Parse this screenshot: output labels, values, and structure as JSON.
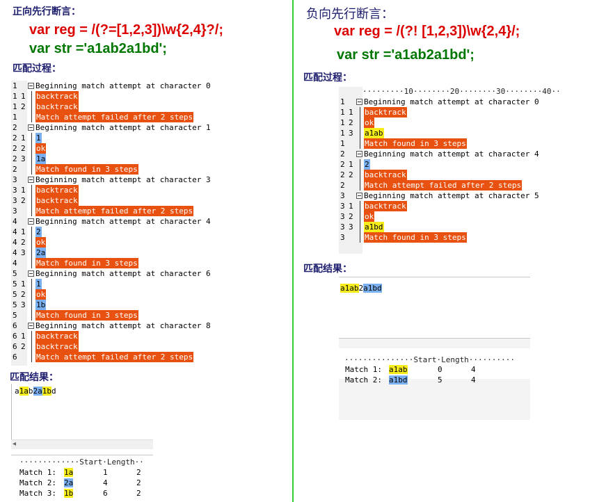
{
  "left": {
    "title": "正向先行断言：",
    "regex": "var reg = /(?=[1,2,3])\\w{2,4}?/;",
    "str": "var str ='a1ab2a1bd';",
    "process_label": "匹配过程：",
    "trace": [
      {
        "ln": "1",
        "step": "",
        "box": true,
        "text": "Beginning match attempt at character 0",
        "style": "plain"
      },
      {
        "ln": "1",
        "step": "1",
        "box": false,
        "text": "backtrack",
        "style": "orange"
      },
      {
        "ln": "1",
        "step": "2",
        "box": false,
        "text": "backtrack",
        "style": "orange"
      },
      {
        "ln": "1",
        "step": "",
        "box": false,
        "text": "Match attempt failed after 2 steps",
        "style": "orange"
      },
      {
        "ln": "2",
        "step": "",
        "box": true,
        "text": "Beginning match attempt at character 1",
        "style": "plain"
      },
      {
        "ln": "2",
        "step": "1",
        "box": false,
        "text": "1",
        "style": "blue"
      },
      {
        "ln": "2",
        "step": "2",
        "box": false,
        "text": "ok",
        "style": "orange"
      },
      {
        "ln": "2",
        "step": "3",
        "box": false,
        "text": "1a",
        "style": "blue"
      },
      {
        "ln": "2",
        "step": "",
        "box": false,
        "text": "Match found in 3 steps",
        "style": "orange"
      },
      {
        "ln": "3",
        "step": "",
        "box": true,
        "text": "Beginning match attempt at character 3",
        "style": "plain"
      },
      {
        "ln": "3",
        "step": "1",
        "box": false,
        "text": "backtrack",
        "style": "orange"
      },
      {
        "ln": "3",
        "step": "2",
        "box": false,
        "text": "backtrack",
        "style": "orange"
      },
      {
        "ln": "3",
        "step": "",
        "box": false,
        "text": "Match attempt failed after 2 steps",
        "style": "orange"
      },
      {
        "ln": "4",
        "step": "",
        "box": true,
        "text": "Beginning match attempt at character 4",
        "style": "plain"
      },
      {
        "ln": "4",
        "step": "1",
        "box": false,
        "text": "2",
        "style": "blue"
      },
      {
        "ln": "4",
        "step": "2",
        "box": false,
        "text": "ok",
        "style": "orange"
      },
      {
        "ln": "4",
        "step": "3",
        "box": false,
        "text": "2a",
        "style": "blue"
      },
      {
        "ln": "4",
        "step": "",
        "box": false,
        "text": "Match found in 3 steps",
        "style": "orange"
      },
      {
        "ln": "5",
        "step": "",
        "box": true,
        "text": "Beginning match attempt at character 6",
        "style": "plain"
      },
      {
        "ln": "5",
        "step": "1",
        "box": false,
        "text": "1",
        "style": "blue"
      },
      {
        "ln": "5",
        "step": "2",
        "box": false,
        "text": "ok",
        "style": "orange"
      },
      {
        "ln": "5",
        "step": "3",
        "box": false,
        "text": "1b",
        "style": "blue"
      },
      {
        "ln": "5",
        "step": "",
        "box": false,
        "text": "Match found in 3 steps",
        "style": "orange"
      },
      {
        "ln": "6",
        "step": "",
        "box": true,
        "text": "Beginning match attempt at character 8",
        "style": "plain"
      },
      {
        "ln": "6",
        "step": "1",
        "box": false,
        "text": "backtrack",
        "style": "orange"
      },
      {
        "ln": "6",
        "step": "2",
        "box": false,
        "text": "backtrack",
        "style": "orange"
      },
      {
        "ln": "6",
        "step": "",
        "box": false,
        "text": "Match attempt failed after 2 steps",
        "style": "orange"
      }
    ],
    "result_label": "匹配结果：",
    "result_segments": [
      {
        "t": "a",
        "c": ""
      },
      {
        "t": "1a",
        "c": "yellow"
      },
      {
        "t": "b",
        "c": ""
      },
      {
        "t": "2a",
        "c": "blue"
      },
      {
        "t": "1b",
        "c": "yellow"
      },
      {
        "t": "d",
        "c": ""
      }
    ],
    "table_header": "·············Start·Length··",
    "matches": [
      {
        "label": "Match 1:",
        "value": "1a",
        "color": "yellow",
        "start": "1",
        "length": "2"
      },
      {
        "label": "Match 2:",
        "value": "2a",
        "color": "blue",
        "start": "4",
        "length": "2"
      },
      {
        "label": "Match 3:",
        "value": "1b",
        "color": "yellow",
        "start": "6",
        "length": "2"
      }
    ]
  },
  "right": {
    "title": "负向先行断言：",
    "regex": "var reg = /(?! [1,2,3])\\w{2,4}/;",
    "str": "var str ='a1ab2a1bd';",
    "process_label": "匹配过程：",
    "ruler": "·········10········20········30········40··",
    "trace": [
      {
        "ln": "1",
        "step": "",
        "box": true,
        "text": "Beginning match attempt at character 0",
        "style": "plain"
      },
      {
        "ln": "1",
        "step": "1",
        "box": false,
        "text": "backtrack",
        "style": "orange"
      },
      {
        "ln": "1",
        "step": "2",
        "box": false,
        "text": "ok",
        "style": "orange"
      },
      {
        "ln": "1",
        "step": "3",
        "box": false,
        "text": "a1ab",
        "style": "yellow"
      },
      {
        "ln": "1",
        "step": "",
        "box": false,
        "text": "Match found in 3 steps",
        "style": "orange"
      },
      {
        "ln": "2",
        "step": "",
        "box": true,
        "text": "Beginning match attempt at character 4",
        "style": "plain"
      },
      {
        "ln": "2",
        "step": "1",
        "box": false,
        "text": "2",
        "style": "blue"
      },
      {
        "ln": "2",
        "step": "2",
        "box": false,
        "text": "backtrack",
        "style": "orange"
      },
      {
        "ln": "2",
        "step": "",
        "box": false,
        "text": "Match attempt failed after 2 steps",
        "style": "orange"
      },
      {
        "ln": "3",
        "step": "",
        "box": true,
        "text": "Beginning match attempt at character 5",
        "style": "plain"
      },
      {
        "ln": "3",
        "step": "1",
        "box": false,
        "text": "backtrack",
        "style": "orange"
      },
      {
        "ln": "3",
        "step": "2",
        "box": false,
        "text": "ok",
        "style": "orange"
      },
      {
        "ln": "3",
        "step": "3",
        "box": false,
        "text": "a1bd",
        "style": "yellow"
      },
      {
        "ln": "3",
        "step": "",
        "box": false,
        "text": "Match found in 3 steps",
        "style": "orange"
      }
    ],
    "result_label": "匹配结果：",
    "result_segments": [
      {
        "t": "a1ab",
        "c": "yellow"
      },
      {
        "t": "2",
        "c": ""
      },
      {
        "t": "a1bd",
        "c": "blue"
      }
    ],
    "table_header": "···············Start·Length··········",
    "matches": [
      {
        "label": "Match 1:",
        "value": "a1ab",
        "color": "yellow",
        "start": "0",
        "length": "4"
      },
      {
        "label": "Match 2:",
        "value": "a1bd",
        "color": "blue",
        "start": "5",
        "length": "4"
      }
    ]
  }
}
